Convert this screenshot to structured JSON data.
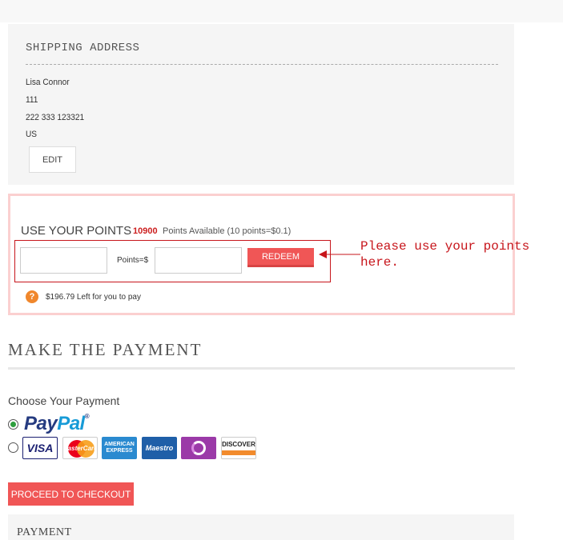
{
  "shipping": {
    "title": "SHIPPING ADDRESS",
    "name": "Lisa Connor",
    "line1": "111",
    "phone": "222 333 123321",
    "country": "US",
    "edit_label": "EDIT"
  },
  "points": {
    "title": "USE YOUR POINTS",
    "count": "10900",
    "available_text": "Points Available (10 points=$0.1)",
    "points_input_value": "",
    "conversion_label": "Points=$",
    "usd_input_value": "",
    "redeem_label": "REDEEM",
    "left_to_pay": "$196.79 Left for you to pay",
    "help_icon": "question-icon"
  },
  "callout": {
    "text_line1": "Please use your points",
    "text_line2": "here.",
    "color": "#c7151b"
  },
  "payment": {
    "section_title": "MAKE THE PAYMENT",
    "choose_label": "Choose Your Payment",
    "paypal_label_part1": "Pay",
    "paypal_label_part2": "Pal",
    "paypal_reg": "®",
    "cards": {
      "visa": "VISA",
      "mastercard": "MasterCard",
      "amex_line1": "AMERICAN",
      "amex_line2": "EXPRESS",
      "maestro": "Maestro",
      "discover": "DISCOVER"
    },
    "checkout_label": "PROCEED TO CHECKOUT",
    "bottom_title": "PAYMENT"
  },
  "colors": {
    "accent": "#f05656",
    "points_border": "#fbd0d0",
    "selected_radio": "#2e9e3e"
  }
}
